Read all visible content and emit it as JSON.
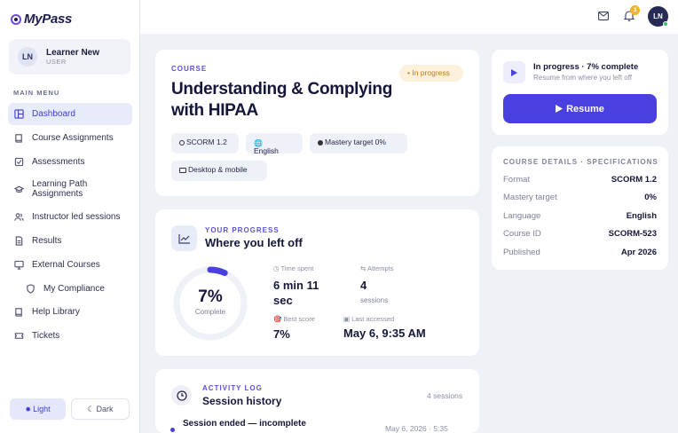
{
  "app": {
    "logo_text": "MyPass"
  },
  "user": {
    "initials": "LN",
    "name": "Learner New",
    "role": "USER"
  },
  "sidebar": {
    "section_label": "MAIN MENU",
    "items": [
      {
        "label": "Dashboard",
        "icon": "dashboard-icon",
        "active": true
      },
      {
        "label": "Course Assignments",
        "icon": "book-icon"
      },
      {
        "label": "Assessments",
        "icon": "checkbox-icon"
      },
      {
        "label": "Learning Path Assignments",
        "icon": "graduation-cap-icon"
      },
      {
        "label": "Instructor led sessions",
        "icon": "users-icon"
      },
      {
        "label": "Results",
        "icon": "document-icon"
      },
      {
        "label": "External Courses",
        "icon": "monitor-icon"
      },
      {
        "label": "My Compliance",
        "icon": "shield-icon"
      },
      {
        "label": "Help Library",
        "icon": "book-icon"
      },
      {
        "label": "Tickets",
        "icon": "ticket-icon"
      }
    ],
    "theme_light": "Light",
    "theme_dark": "Dark"
  },
  "topbar": {
    "notification_count": "3",
    "avatar_initials": "LN"
  },
  "course": {
    "eyebrow": "COURSE",
    "title": "Understanding & Complying with HIPAA",
    "status": "In progress",
    "chips": {
      "format": "SCORM 1.2",
      "language": "English",
      "mastery": "Mastery target 0%",
      "device": "Desktop & mobile"
    }
  },
  "progress": {
    "eyebrow": "YOUR PROGRESS",
    "title": "Where you left off",
    "percent": 7,
    "percent_label": "7%",
    "ring_caption": "Complete",
    "time_spent_label": "Time spent",
    "time_spent_value": "6 min 11 sec",
    "attempts_label": "Attempts",
    "attempts_value": "4",
    "attempts_sub": "sessions",
    "best_label": "Best score",
    "best_value": "7%",
    "last_accessed_label": "Last accessed",
    "last_accessed_value": "May 6, 9:35 AM"
  },
  "activity": {
    "eyebrow": "ACTIVITY LOG",
    "title": "Session history",
    "count": "4 sessions",
    "entries": [
      {
        "label": "Session ended — incomplete",
        "time": "May 6, 2026 · 5:35"
      }
    ]
  },
  "resume": {
    "status": "In progress · 7% complete",
    "hint": "Resume from where you left off",
    "button_label": "Resume"
  },
  "details": {
    "header": "COURSE DETAILS · SPECIFICATIONS",
    "rows": [
      {
        "key": "Format",
        "value": "SCORM 1.2"
      },
      {
        "key": "Mastery target",
        "value": "0%"
      },
      {
        "key": "Language",
        "value": "English"
      },
      {
        "key": "Course ID",
        "value": "SCORM-523"
      },
      {
        "key": "Published",
        "value": "Apr 2026"
      }
    ]
  },
  "colors": {
    "accent": "#4a40e0",
    "status_bg": "#fdf1dc",
    "status_text": "#c27a10",
    "online": "#35c16f"
  }
}
